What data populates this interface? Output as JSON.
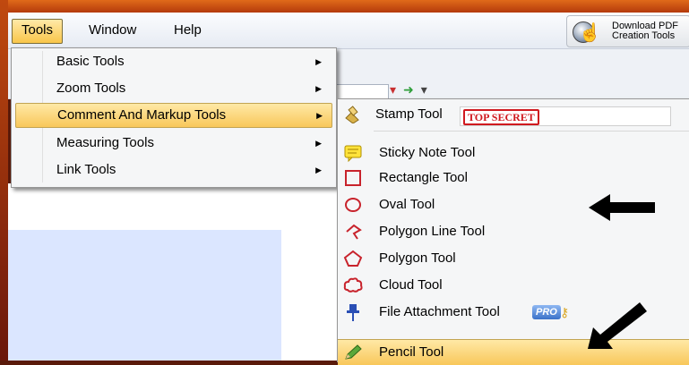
{
  "menubar": {
    "items": [
      {
        "label": "Tools",
        "active": true
      },
      {
        "label": "Window",
        "active": false
      },
      {
        "label": "Help",
        "active": false
      }
    ]
  },
  "download_button": {
    "line1": "Download PDF",
    "line2": "Creation Tools"
  },
  "tools_menu": {
    "items": [
      {
        "label": "Basic Tools",
        "highlighted": false
      },
      {
        "label": "Zoom Tools",
        "highlighted": false
      },
      {
        "label": "Comment And Markup Tools",
        "highlighted": true
      },
      {
        "label": "Measuring Tools",
        "highlighted": false
      },
      {
        "label": "Link Tools",
        "highlighted": false
      }
    ]
  },
  "submenu": {
    "stamp": {
      "label": "Stamp Tool",
      "stamp_text": "TOP SECRET",
      "icon": "stamp-icon"
    },
    "items": [
      {
        "label": "Sticky Note Tool",
        "icon": "sticky-note-icon",
        "color": "#e8c200"
      },
      {
        "label": "Rectangle Tool",
        "icon": "rectangle-icon",
        "color": "#c8232c"
      },
      {
        "label": "Oval Tool",
        "icon": "oval-icon",
        "color": "#c8232c"
      },
      {
        "label": "Polygon Line Tool",
        "icon": "polygon-line-icon",
        "color": "#c8232c"
      },
      {
        "label": "Polygon Tool",
        "icon": "polygon-icon",
        "color": "#c8232c"
      },
      {
        "label": "Cloud Tool",
        "icon": "cloud-icon",
        "color": "#c8232c"
      },
      {
        "label": "File Attachment Tool",
        "icon": "pushpin-icon",
        "color": "#2a4fb5",
        "badge": "PRO"
      },
      {
        "label": "Pencil Tool",
        "icon": "pencil-icon",
        "color": "#3a8a2a",
        "highlighted": true
      }
    ]
  },
  "colors": {
    "highlight": "#f8c75a",
    "frame": "#b43a0c",
    "menu_bg": "#f5f6f7",
    "accent_red": "#d0191f"
  }
}
